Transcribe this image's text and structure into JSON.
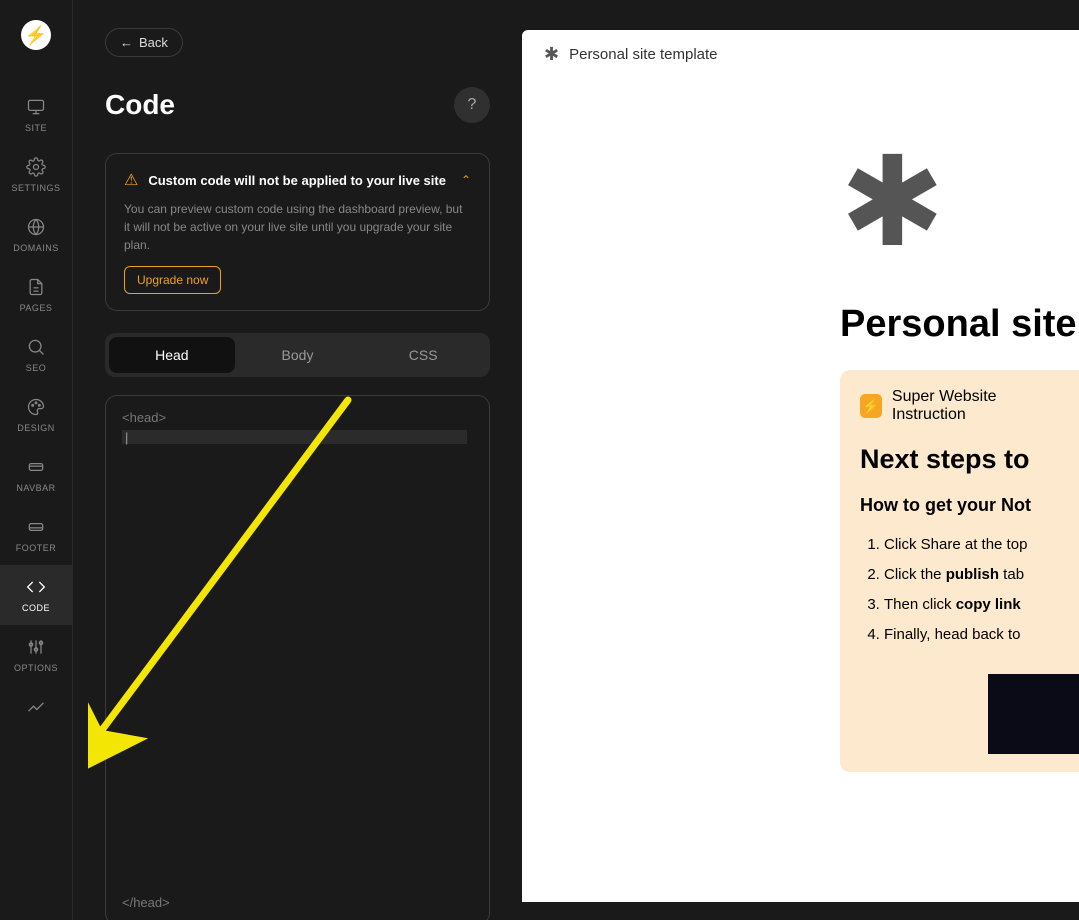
{
  "sidebar": {
    "items": [
      {
        "label": "SITE"
      },
      {
        "label": "SETTINGS"
      },
      {
        "label": "DOMAINS"
      },
      {
        "label": "PAGES"
      },
      {
        "label": "SEO"
      },
      {
        "label": "DESIGN"
      },
      {
        "label": "NAVBAR"
      },
      {
        "label": "FOOTER"
      },
      {
        "label": "CODE"
      },
      {
        "label": "OPTIONS"
      }
    ],
    "active_index": 8
  },
  "panel": {
    "back_label": "Back",
    "title": "Code",
    "notice_title": "Custom code will not be applied to your live site",
    "notice_body": "You can preview custom code using the dashboard preview, but it will not be active on your live site until you upgrade your site plan.",
    "upgrade_label": "Upgrade now",
    "tabs": [
      {
        "label": "Head"
      },
      {
        "label": "Body"
      },
      {
        "label": "CSS"
      }
    ],
    "active_tab": 0,
    "code_open": "<head>",
    "code_close": "</head>"
  },
  "preview": {
    "breadcrumb": "Personal site template",
    "hero": "Personal site",
    "callout_label": "Super Website Instruction",
    "next_heading": "Next steps to",
    "how_heading": "How to get your Not",
    "steps": [
      {
        "text": "Click Share at the top"
      },
      {
        "a": "Click the ",
        "b": "publish",
        "c": " tab"
      },
      {
        "a": "Then click ",
        "b": "copy link",
        "c": ""
      },
      {
        "text": "Finally, head back to"
      }
    ]
  }
}
